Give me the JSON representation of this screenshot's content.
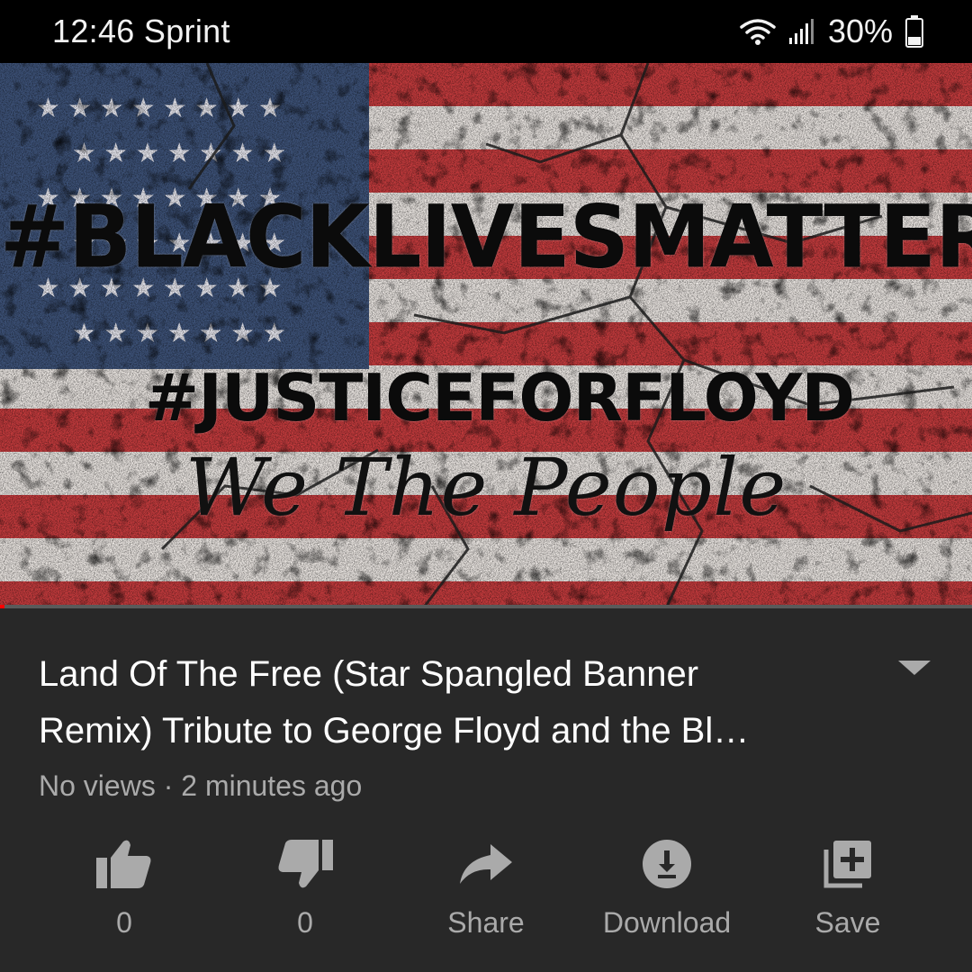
{
  "status_bar": {
    "time": "12:46",
    "carrier": "Sprint",
    "battery": "30%",
    "wifi_icon": "wifi-icon",
    "signal_icon": "signal-icon",
    "battery_icon": "battery-icon"
  },
  "video": {
    "overlay_line1": "#BLACKLIVESMATTER",
    "overlay_line2": "#JUSTICEFORFLOYD",
    "overlay_line3": "We The People",
    "progress": 0.005,
    "colors": {
      "progress": "#ff0000",
      "track": "#5a5a5a"
    }
  },
  "info": {
    "title_line1": "Land Of The Free (Star Spangled Banner",
    "title_line2": "Remix) Tribute to George Floyd and the Bl…",
    "meta": "No views · 2 minutes ago",
    "expand_icon": "chevron-down-icon"
  },
  "actions": [
    {
      "name": "like",
      "label": "0",
      "icon": "thumbs-up-icon"
    },
    {
      "name": "dislike",
      "label": "0",
      "icon": "thumbs-down-icon"
    },
    {
      "name": "share",
      "label": "Share",
      "icon": "share-arrow-icon"
    },
    {
      "name": "download",
      "label": "Download",
      "icon": "download-icon"
    },
    {
      "name": "save",
      "label": "Save",
      "icon": "playlist-add-icon"
    }
  ],
  "theme": {
    "background": "#282828",
    "text": "#ffffff",
    "secondary": "#aaaaaa"
  }
}
